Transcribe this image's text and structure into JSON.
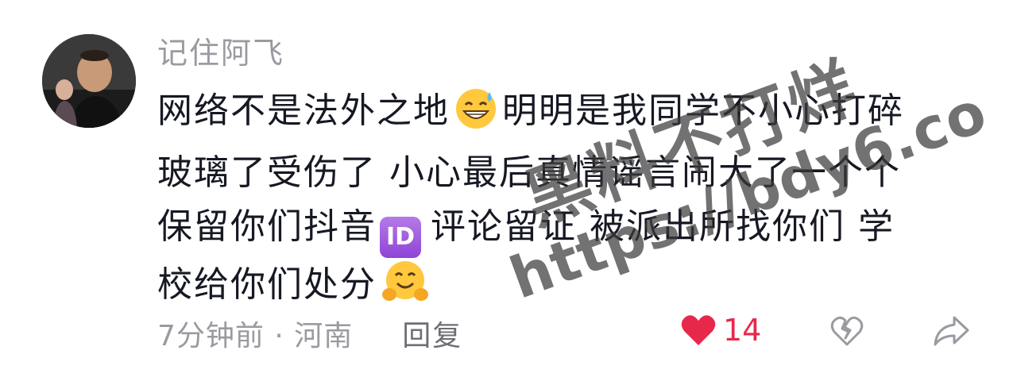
{
  "comment": {
    "username": "记住阿飞",
    "content": {
      "line1_a": "网络不是法外之地",
      "line1_b": "明明是我同学不小心打碎",
      "line2": "玻璃了受伤了 小心最后真情谣言闹大了一个个",
      "line3_a": "保留你们抖音",
      "line3_badge": "ID",
      "line3_b": "评论留证 被派出所找你们 学",
      "line4": "校给你们处分"
    },
    "meta": "7分钟前 · 河南",
    "reply_label": "回复",
    "like_count": "14",
    "colors": {
      "like": "#e8284b",
      "meta": "#9a9aa0",
      "text": "#161823"
    },
    "icons": [
      "grinning-sweat-emoji",
      "id-badge-icon",
      "hugging-face-emoji",
      "heart-icon",
      "broken-heart-icon",
      "share-arrow-icon"
    ]
  },
  "watermark": {
    "line1": "黑料不打烊",
    "line2": "https://bdy6.co"
  }
}
